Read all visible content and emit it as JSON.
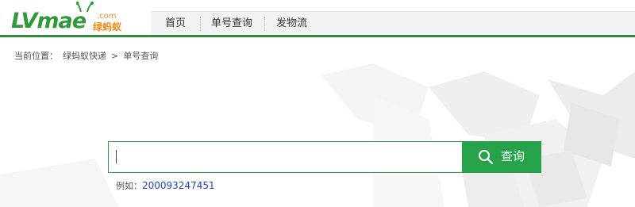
{
  "logo": {
    "wordmark": "LVmae",
    "domain_suffix": ".com",
    "chinese_name": "绿蚂蚁"
  },
  "nav": {
    "items": [
      {
        "label": "首页"
      },
      {
        "label": "单号查询"
      },
      {
        "label": "发物流"
      }
    ]
  },
  "breadcrumb": {
    "prefix": "当前位置：",
    "items": [
      {
        "label": "绿蚂蚁快递"
      },
      {
        "label": "单号查询"
      }
    ],
    "separator": ">"
  },
  "search": {
    "value": "",
    "placeholder": "",
    "button_label": "查询"
  },
  "example": {
    "prefix": "例如：",
    "number": "200093247451"
  },
  "colors": {
    "brand_green": "#2e9a3a",
    "button_green": "#26a34a",
    "accent_orange": "#f08a1c",
    "link_blue": "#2242c4"
  },
  "icons": {
    "search": "search-icon"
  }
}
